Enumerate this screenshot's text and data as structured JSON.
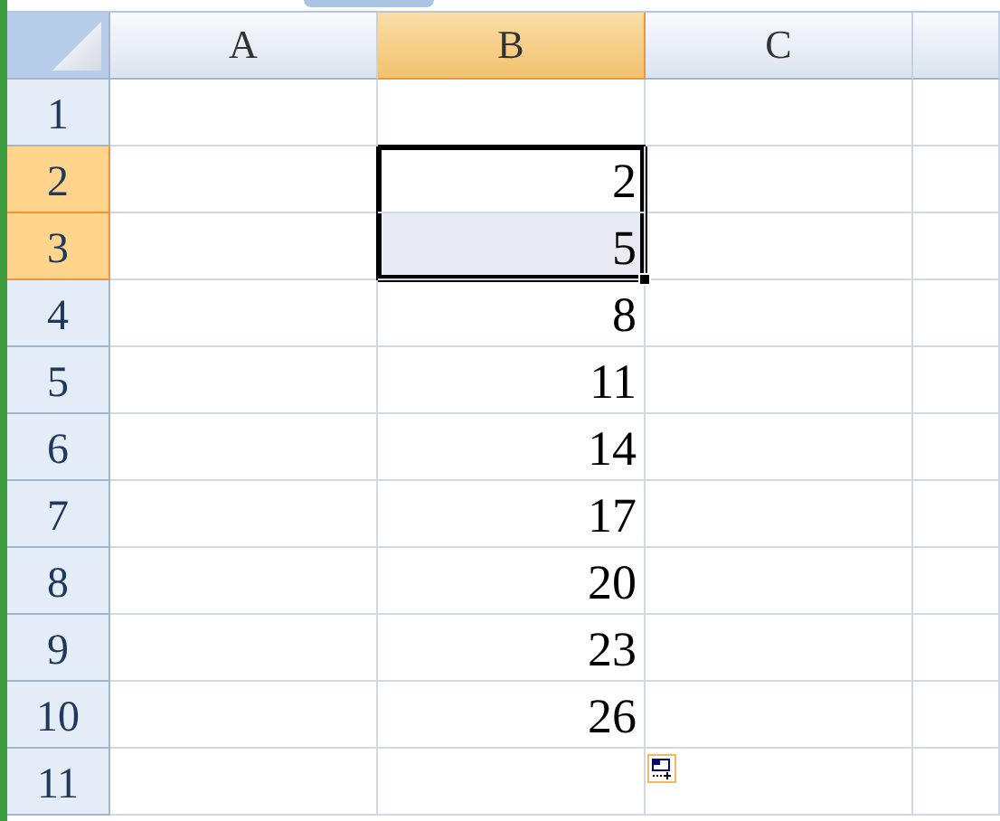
{
  "columns": [
    {
      "label": "A",
      "selected": false
    },
    {
      "label": "B",
      "selected": true
    },
    {
      "label": "C",
      "selected": false
    }
  ],
  "rows": [
    {
      "label": "1",
      "selected": false,
      "cells": [
        {
          "selected": false
        },
        {
          "selected": false
        },
        {
          "selected": false
        }
      ]
    },
    {
      "label": "2",
      "selected": true,
      "cells": [
        {
          "selected": false
        },
        {
          "text": "2",
          "selected": true,
          "active": true
        },
        {
          "selected": false
        }
      ]
    },
    {
      "label": "3",
      "selected": true,
      "cells": [
        {
          "selected": false
        },
        {
          "text": "5",
          "selected": true,
          "active": false
        },
        {
          "selected": false
        }
      ]
    },
    {
      "label": "4",
      "selected": false,
      "cells": [
        {
          "selected": false
        },
        {
          "text": "8",
          "selected": false
        },
        {
          "selected": false
        }
      ]
    },
    {
      "label": "5",
      "selected": false,
      "cells": [
        {
          "selected": false
        },
        {
          "text": "11",
          "selected": false
        },
        {
          "selected": false
        }
      ]
    },
    {
      "label": "6",
      "selected": false,
      "cells": [
        {
          "selected": false
        },
        {
          "text": "14",
          "selected": false
        },
        {
          "selected": false
        }
      ]
    },
    {
      "label": "7",
      "selected": false,
      "cells": [
        {
          "selected": false
        },
        {
          "text": "17",
          "selected": false
        },
        {
          "selected": false
        }
      ]
    },
    {
      "label": "8",
      "selected": false,
      "cells": [
        {
          "selected": false
        },
        {
          "text": "20",
          "selected": false
        },
        {
          "selected": false
        }
      ]
    },
    {
      "label": "9",
      "selected": false,
      "cells": [
        {
          "selected": false
        },
        {
          "text": "23",
          "selected": false
        },
        {
          "selected": false
        }
      ]
    },
    {
      "label": "10",
      "selected": false,
      "cells": [
        {
          "selected": false
        },
        {
          "text": "26",
          "selected": false
        },
        {
          "selected": false
        }
      ]
    },
    {
      "label": "11",
      "selected": false,
      "cells": [
        {
          "selected": false
        },
        {
          "selected": false
        },
        {
          "selected": false
        }
      ]
    }
  ]
}
